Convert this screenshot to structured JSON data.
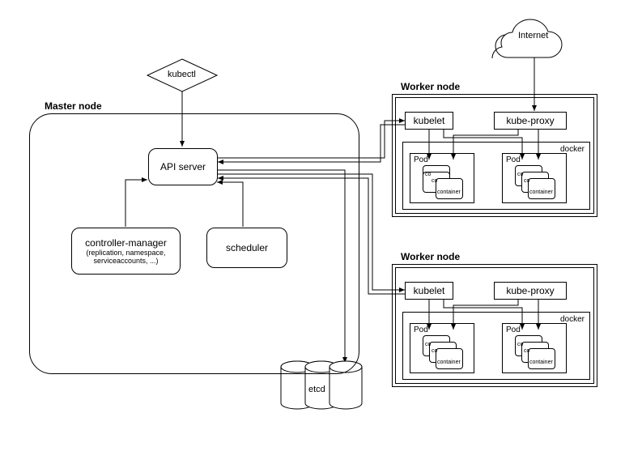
{
  "diagram": {
    "internet": "Internet",
    "master_node_title": "Master node",
    "kubectl": "kubectl",
    "api_server": "API server",
    "controller_manager": {
      "title": "controller-manager",
      "subtitle": "(replication, namespace, serviceaccounts, ...)"
    },
    "scheduler": "scheduler",
    "etcd": "etcd",
    "worker_node_title": "Worker node",
    "kubelet": "kubelet",
    "kube_proxy": "kube-proxy",
    "docker": "docker",
    "pod": "Pod",
    "container": "container",
    "container_short": "co"
  }
}
